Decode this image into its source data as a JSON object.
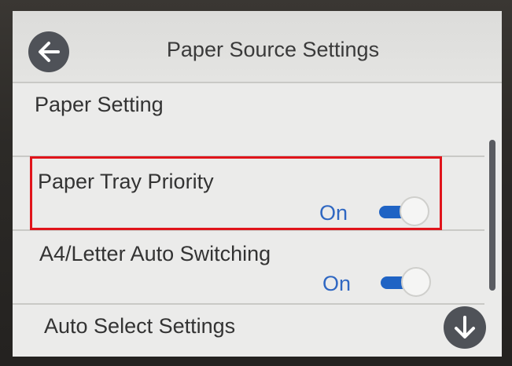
{
  "header": {
    "title": "Paper Source Settings",
    "back_icon": "arrow-left-icon"
  },
  "list": {
    "items": [
      {
        "label": "Paper Setting"
      },
      {
        "label": "Paper Tray Priority",
        "value": "On",
        "toggle_on": true
      },
      {
        "label": "A4/Letter Auto Switching",
        "value": "On",
        "toggle_on": true
      },
      {
        "label": "Auto Select Settings"
      }
    ]
  },
  "scroll": {
    "down_icon": "arrow-down-icon"
  },
  "colors": {
    "accent": "#1f63c4",
    "value_text": "#2f67c2",
    "highlight": "#e0141b",
    "button_bg": "#4f5258"
  }
}
